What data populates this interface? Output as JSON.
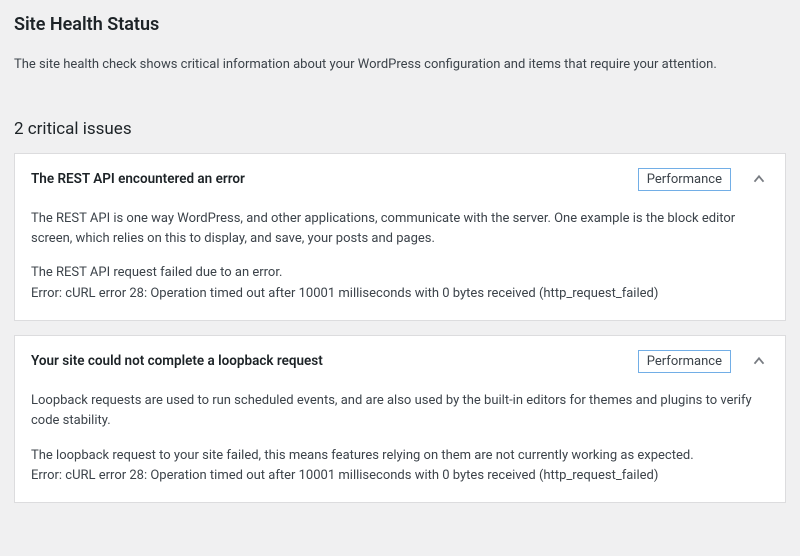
{
  "header": {
    "title": "Site Health Status",
    "description": "The site health check shows critical information about your WordPress configuration and items that require your attention."
  },
  "issues": {
    "heading": "2 critical issues",
    "items": [
      {
        "title": "The REST API encountered an error",
        "badge": "Performance",
        "paragraphs": [
          "The REST API is one way WordPress, and other applications, communicate with the server. One example is the block editor screen, which relies on this to display, and save, your posts and pages.",
          "The REST API request failed due to an error.\nError: cURL error 28: Operation timed out after 10001 milliseconds with 0 bytes received (http_request_failed)"
        ]
      },
      {
        "title": "Your site could not complete a loopback request",
        "badge": "Performance",
        "paragraphs": [
          "Loopback requests are used to run scheduled events, and are also used by the built-in editors for themes and plugins to verify code stability.",
          "The loopback request to your site failed, this means features relying on them are not currently working as expected.\nError: cURL error 28: Operation timed out after 10001 milliseconds with 0 bytes received (http_request_failed)"
        ]
      }
    ]
  }
}
